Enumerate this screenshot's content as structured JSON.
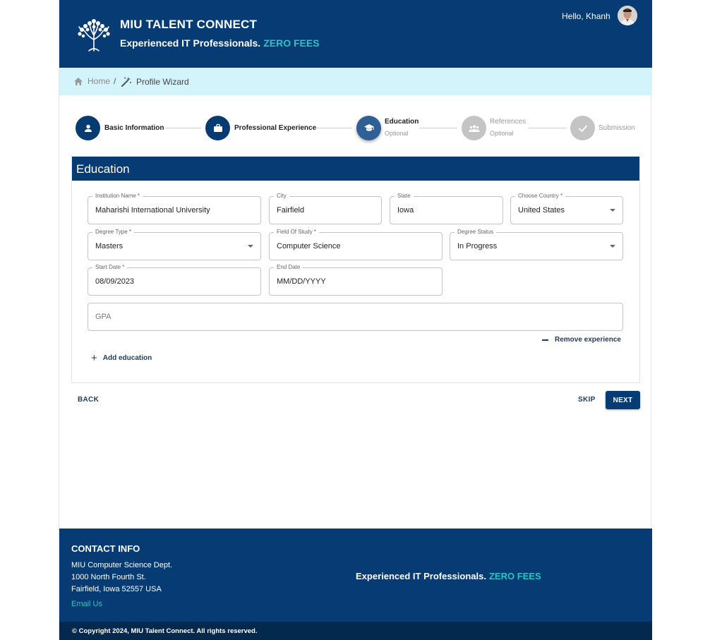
{
  "header": {
    "title": "MIU TALENT CONNECT",
    "tagline": "Experienced IT Professionals.",
    "tagline_highlight": "ZERO FEES",
    "greeting": "Hello, Khanh"
  },
  "breadcrumb": {
    "home": "Home",
    "separator": "/",
    "current": "Profile Wizard"
  },
  "stepper": {
    "steps": [
      {
        "label": "Basic Information",
        "state": "completed",
        "icon": "person-icon"
      },
      {
        "label": "Professional Experience",
        "state": "completed",
        "icon": "briefcase-icon"
      },
      {
        "label": "Education",
        "optional": "Optional",
        "state": "active",
        "icon": "graduation-cap-icon"
      },
      {
        "label": "References",
        "optional": "Optional",
        "state": "pending",
        "icon": "group-icon"
      },
      {
        "label": "Submission",
        "state": "pending",
        "icon": "check-icon"
      }
    ]
  },
  "form": {
    "section_title": "Education",
    "fields": {
      "institution": {
        "label": "Institution Name *",
        "value": "Maharishi International University"
      },
      "city": {
        "label": "City",
        "value": "Fairfield"
      },
      "state": {
        "label": "State",
        "value": "Iowa"
      },
      "country": {
        "label": "Choose Country *",
        "value": "United States"
      },
      "degree_type": {
        "label": "Degree Type *",
        "value": "Masters"
      },
      "field_of_study": {
        "label": "Field Of Study *",
        "value": "Computer Science"
      },
      "degree_status": {
        "label": "Degree Status",
        "value": "In Progress"
      },
      "start_date": {
        "label": "Start Date *",
        "value": "08/09/2023"
      },
      "end_date": {
        "label": "End Date",
        "value": "MM/DD/YYYY"
      },
      "gpa": {
        "placeholder": "GPA"
      }
    },
    "remove_label": "Remove experience",
    "add_label": "Add education"
  },
  "actions": {
    "back": "BACK",
    "skip": "SKIP",
    "next": "NEXT"
  },
  "footer": {
    "contact_title": "CONTACT INFO",
    "address_lines": [
      "MIU Computer Science Dept.",
      "1000 North Fourth St.",
      "Fairfield, Iowa 52557 USA"
    ],
    "email_link": "Email Us",
    "tagline": "Experienced IT Professionals.",
    "tagline_highlight": "ZERO FEES",
    "copyright": "© Copyright 2024, MIU Talent Connect. All rights reserved."
  },
  "colors": {
    "primary": "#063b73",
    "accent": "#2bc4c4",
    "breadcrumb_bg": "#d4f4fb",
    "pending_step": "#c4c4c4"
  }
}
